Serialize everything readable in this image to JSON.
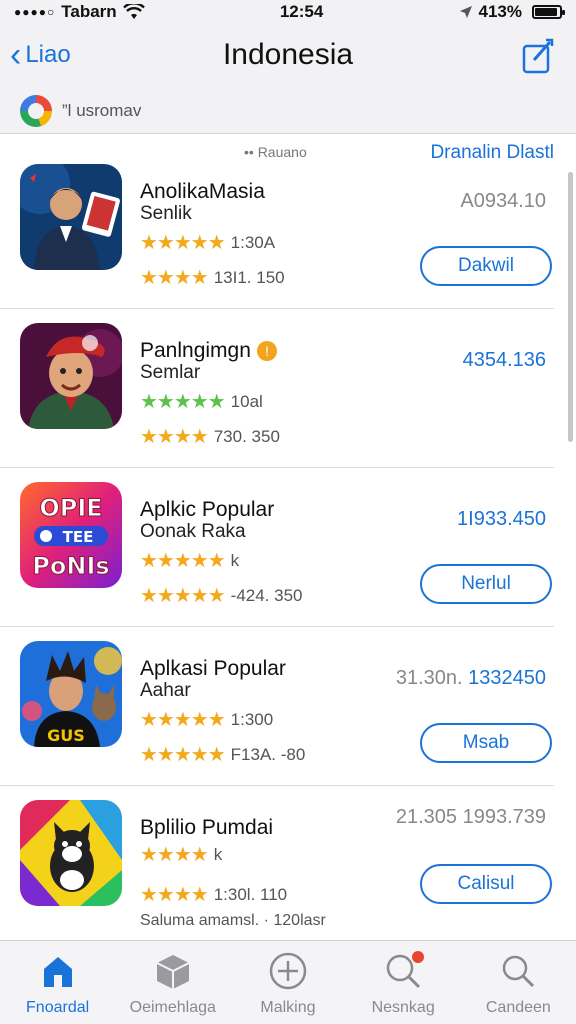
{
  "status_bar": {
    "carrier": "Tabarn",
    "time": "12:54",
    "battery": "4​13%"
  },
  "nav": {
    "back_label": "Liao",
    "title": "Indonesia"
  },
  "account": {
    "label": "usromav",
    "prefix": "”l"
  },
  "list_header": {
    "sort_label": "•• Rauano",
    "link": "Dranalin Dlastl"
  },
  "apps": [
    {
      "name": "AnolikaMasia",
      "subtitle": "Senlik",
      "rating1": "1:30A",
      "rating2": "13I1.   150",
      "price": "A0934.10",
      "button": "Dakwil",
      "icon": "person-cards-icon"
    },
    {
      "name": "Panlngimgn",
      "subtitle": "Semlar",
      "rating1": "10al",
      "rating2": "730.   350",
      "price": "4354.136",
      "button": "",
      "icon": "cartoon-man-icon"
    },
    {
      "name": "Aplkic Popular",
      "subtitle": "Oonak Raka",
      "rating1": "k",
      "rating2": "-424.   350",
      "price": "1I933.450",
      "button": "Nerlul",
      "icon": "ope-tee-ponis-icon"
    },
    {
      "name": "Aplkasi Popular",
      "subtitle": "Aahar",
      "rating1": "1:300",
      "rating2": "F13A.   -80",
      "price_grey": "31.30n.",
      "price": "1332450",
      "button": "Msab",
      "icon": "guy-with-dog-icon"
    },
    {
      "name": "Bplilio Pumdai",
      "subtitle": "",
      "rating1": "k",
      "rating2": "1:30l.   110",
      "price": "21.305  1993.739",
      "button": "Calisul",
      "footer": "Saluma amamsl. ·  120lasr",
      "icon": "cat-rainbow-icon"
    }
  ],
  "tabs": [
    {
      "label": "Fnoardal",
      "icon": "home-icon"
    },
    {
      "label": "Oeimehlaga",
      "icon": "box-icon"
    },
    {
      "label": "Malking",
      "icon": "plus-circle-icon"
    },
    {
      "label": "Nesnkag",
      "icon": "search-badge-icon"
    },
    {
      "label": "Candeen",
      "icon": "search-icon"
    }
  ],
  "colors": {
    "accent": "#1a73d9",
    "star": "#f4a81c",
    "bar_bg": "#f2f2f4"
  }
}
